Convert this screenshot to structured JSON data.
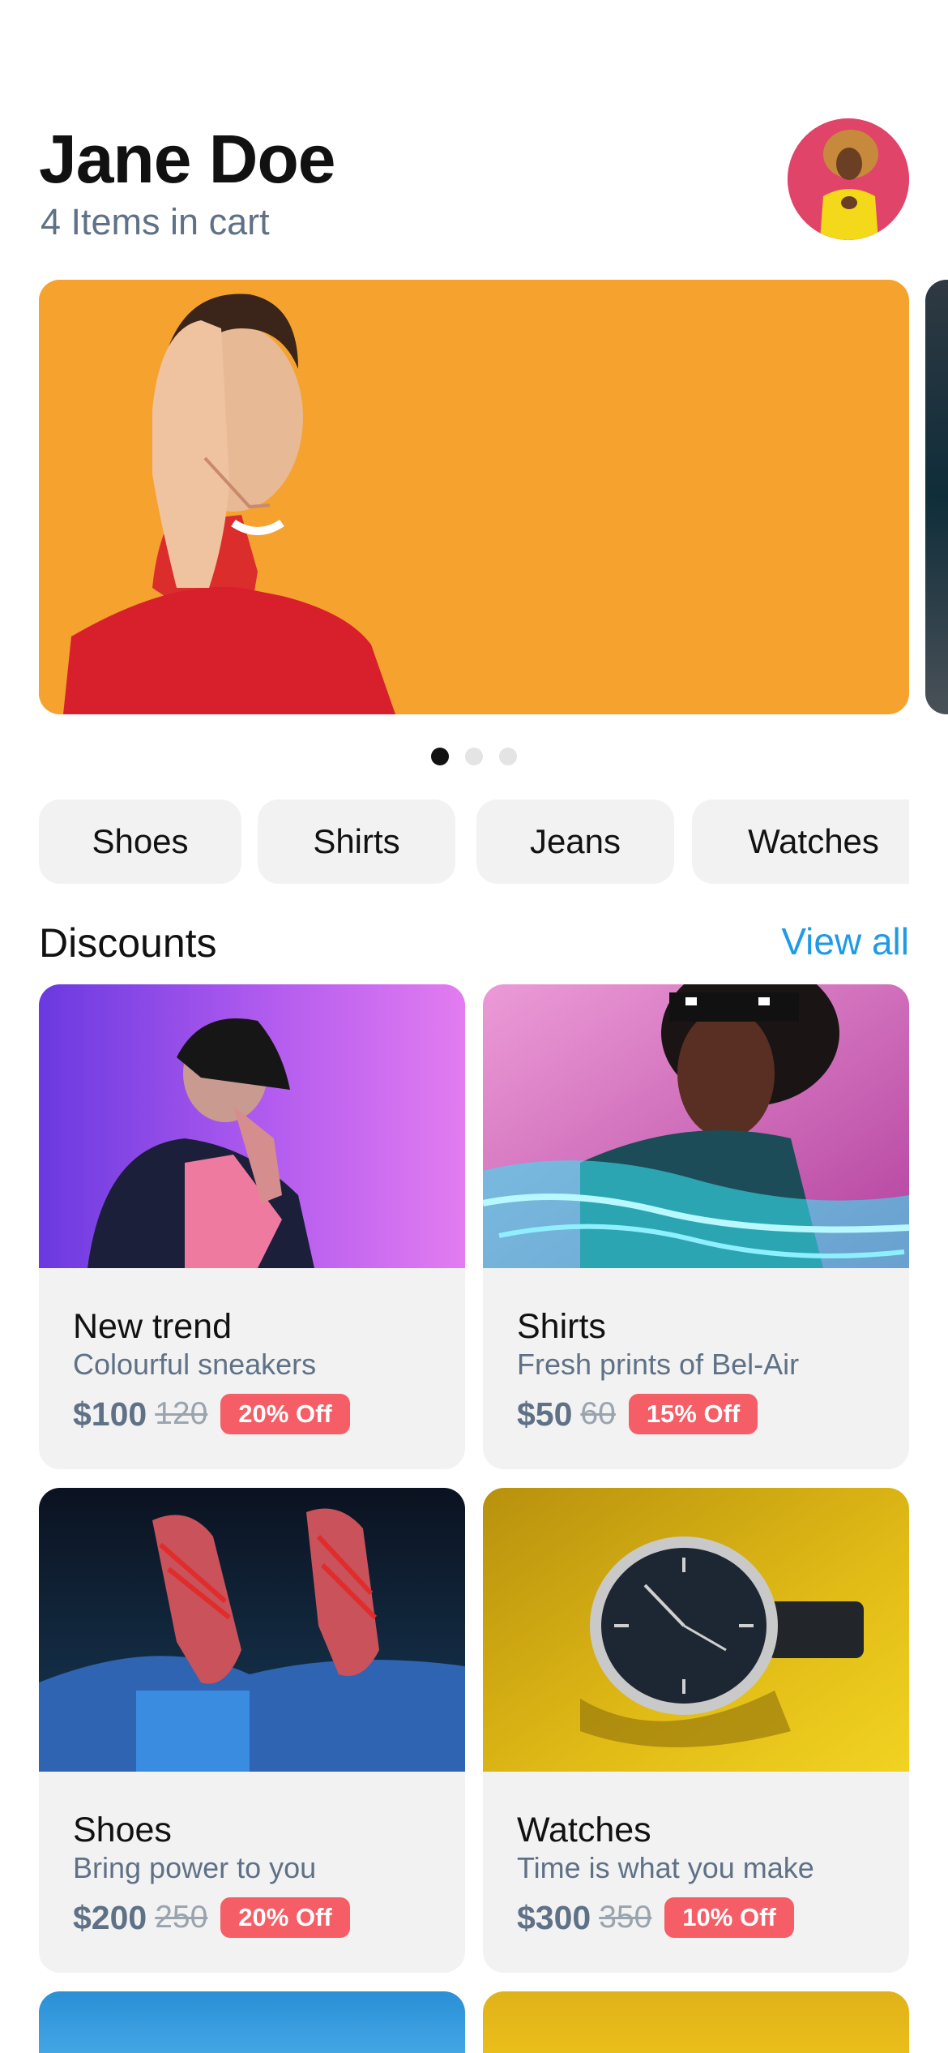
{
  "header": {
    "user_name": "Jane Doe",
    "cart_count": "4 Items in cart"
  },
  "carousel": {
    "slide_count": 3,
    "active_slide": 1
  },
  "categories": [
    "Shoes",
    "Shirts",
    "Jeans",
    "Watches"
  ],
  "discounts": {
    "title": "Discounts",
    "view_all": "View all",
    "products": [
      {
        "title": "New trend",
        "subtitle": "Colourful sneakers",
        "price": "$100",
        "old_price": "120",
        "discount": "20% Off"
      },
      {
        "title": "Shirts",
        "subtitle": "Fresh prints of Bel-Air",
        "price": "$50",
        "old_price": "60",
        "discount": "15% Off"
      },
      {
        "title": "Shoes",
        "subtitle": "Bring power to you",
        "price": "$200",
        "old_price": "250",
        "discount": "20% Off"
      },
      {
        "title": "Watches",
        "subtitle": "Time is what you make",
        "price": "$300",
        "old_price": "350",
        "discount": "10% Off"
      }
    ]
  },
  "colors": {
    "accent_link": "#1f9ae5",
    "badge": "#f55e66",
    "muted_text": "#5f7186",
    "card_bg": "#f2f2f2"
  }
}
